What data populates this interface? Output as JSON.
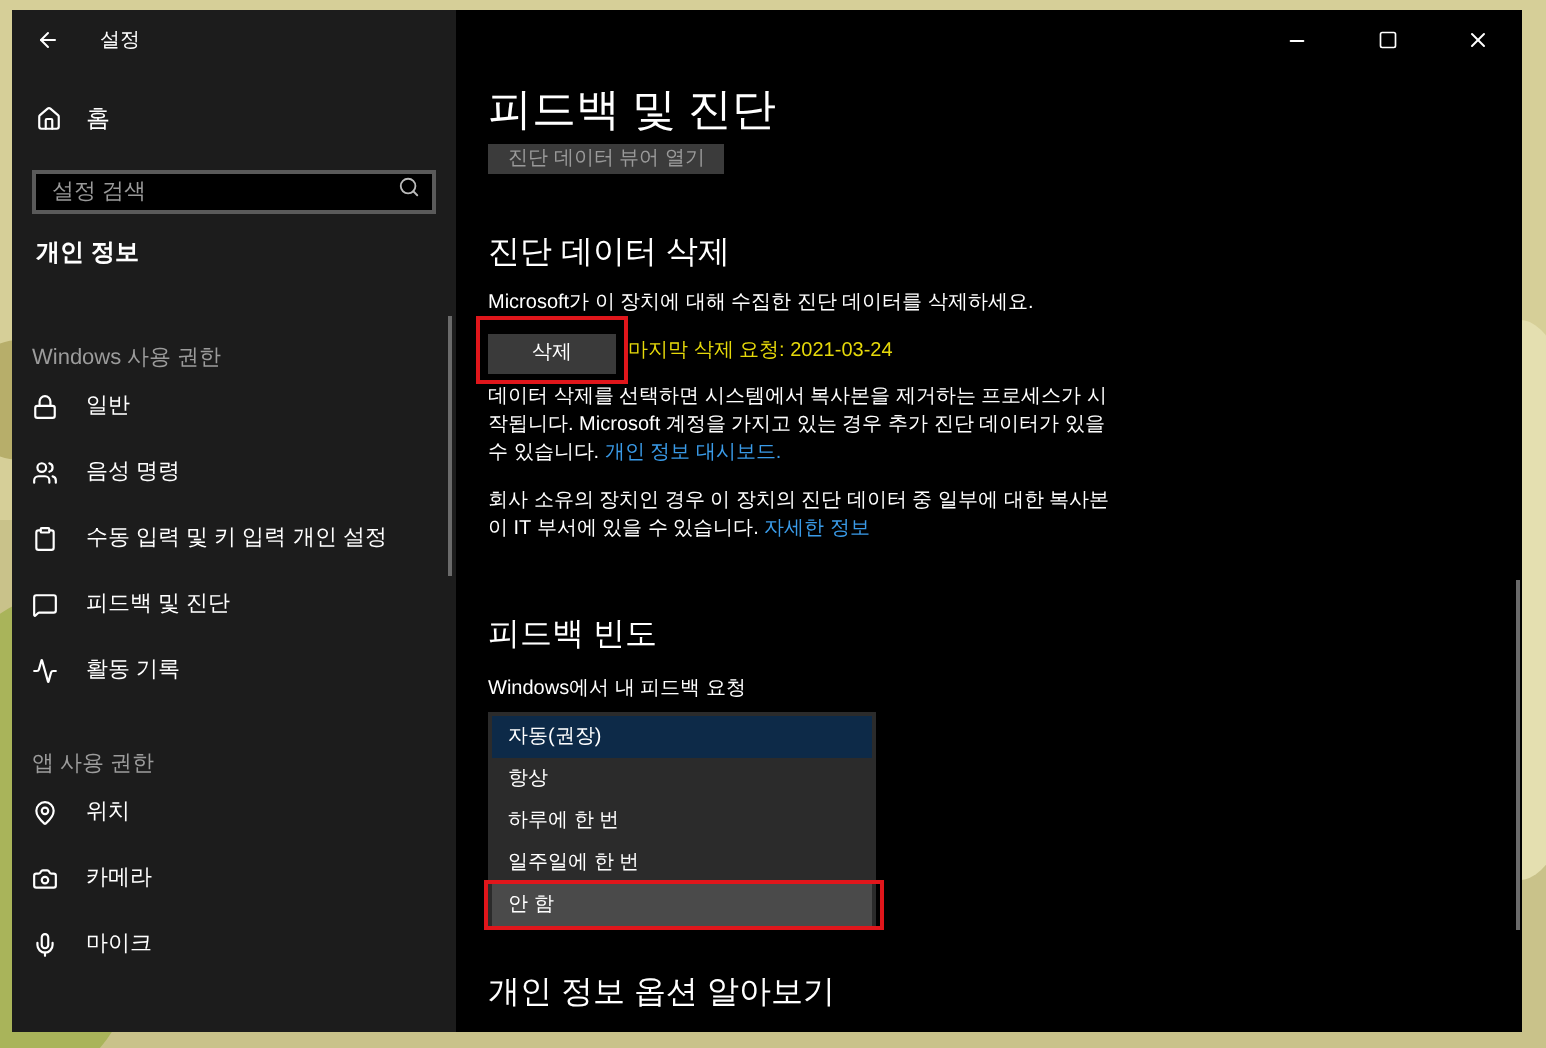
{
  "window": {
    "title": "설정"
  },
  "sidebar": {
    "home": "홈",
    "search": {
      "placeholder": "설정 검색"
    },
    "section_title": "개인 정보",
    "groups": [
      {
        "title": "Windows 사용 권한",
        "items": [
          {
            "label": "일반"
          },
          {
            "label": "음성 명령"
          },
          {
            "label": "수동 입력 및 키 입력 개인 설정"
          },
          {
            "label": "피드백 및 진단"
          },
          {
            "label": "활동 기록"
          }
        ]
      },
      {
        "title": "앱 사용 권한",
        "items": [
          {
            "label": "위치"
          },
          {
            "label": "카메라"
          },
          {
            "label": "마이크"
          }
        ]
      }
    ]
  },
  "main": {
    "title": "피드백 및 진단",
    "viewer_button": "진단 데이터 뷰어 열기",
    "delete_section": {
      "heading": "진단 데이터 삭제",
      "description": "Microsoft가 이 장치에 대해 수집한 진단 데이터를 삭제하세요.",
      "button": {
        "label": "삭제",
        "highlighted": true
      },
      "last_request": "마지막 삭제 요청: 2021-03-24",
      "paragraphs": [
        {
          "text": "데이터 삭제를 선택하면 시스템에서 복사본을 제거하는 프로세스가 시작됩니다. Microsoft 계정을 가지고 있는 경우 추가 진단 데이터가 있을 수 있습니다.",
          "link": "개인 정보 대시보드."
        },
        {
          "text": "회사 소유의 장치인 경우 이 장치의 진단 데이터 중 일부에 대한 복사본이 IT 부서에 있을 수 있습니다.",
          "link": "자세한 정보"
        }
      ]
    },
    "frequency_section": {
      "heading": "피드백 빈도",
      "label": "Windows에서 내 피드백 요청",
      "options": [
        {
          "label": "자동(권장)",
          "selected": true,
          "hovered": false,
          "highlighted": false
        },
        {
          "label": "항상",
          "selected": false,
          "hovered": false,
          "highlighted": false
        },
        {
          "label": "하루에 한 번",
          "selected": false,
          "hovered": false,
          "highlighted": false
        },
        {
          "label": "일주일에 한 번",
          "selected": false,
          "hovered": false,
          "highlighted": false
        },
        {
          "label": "안 함",
          "selected": false,
          "hovered": true,
          "highlighted": true
        }
      ]
    },
    "next_heading": "개인 정보 옵션 알아보기"
  }
}
